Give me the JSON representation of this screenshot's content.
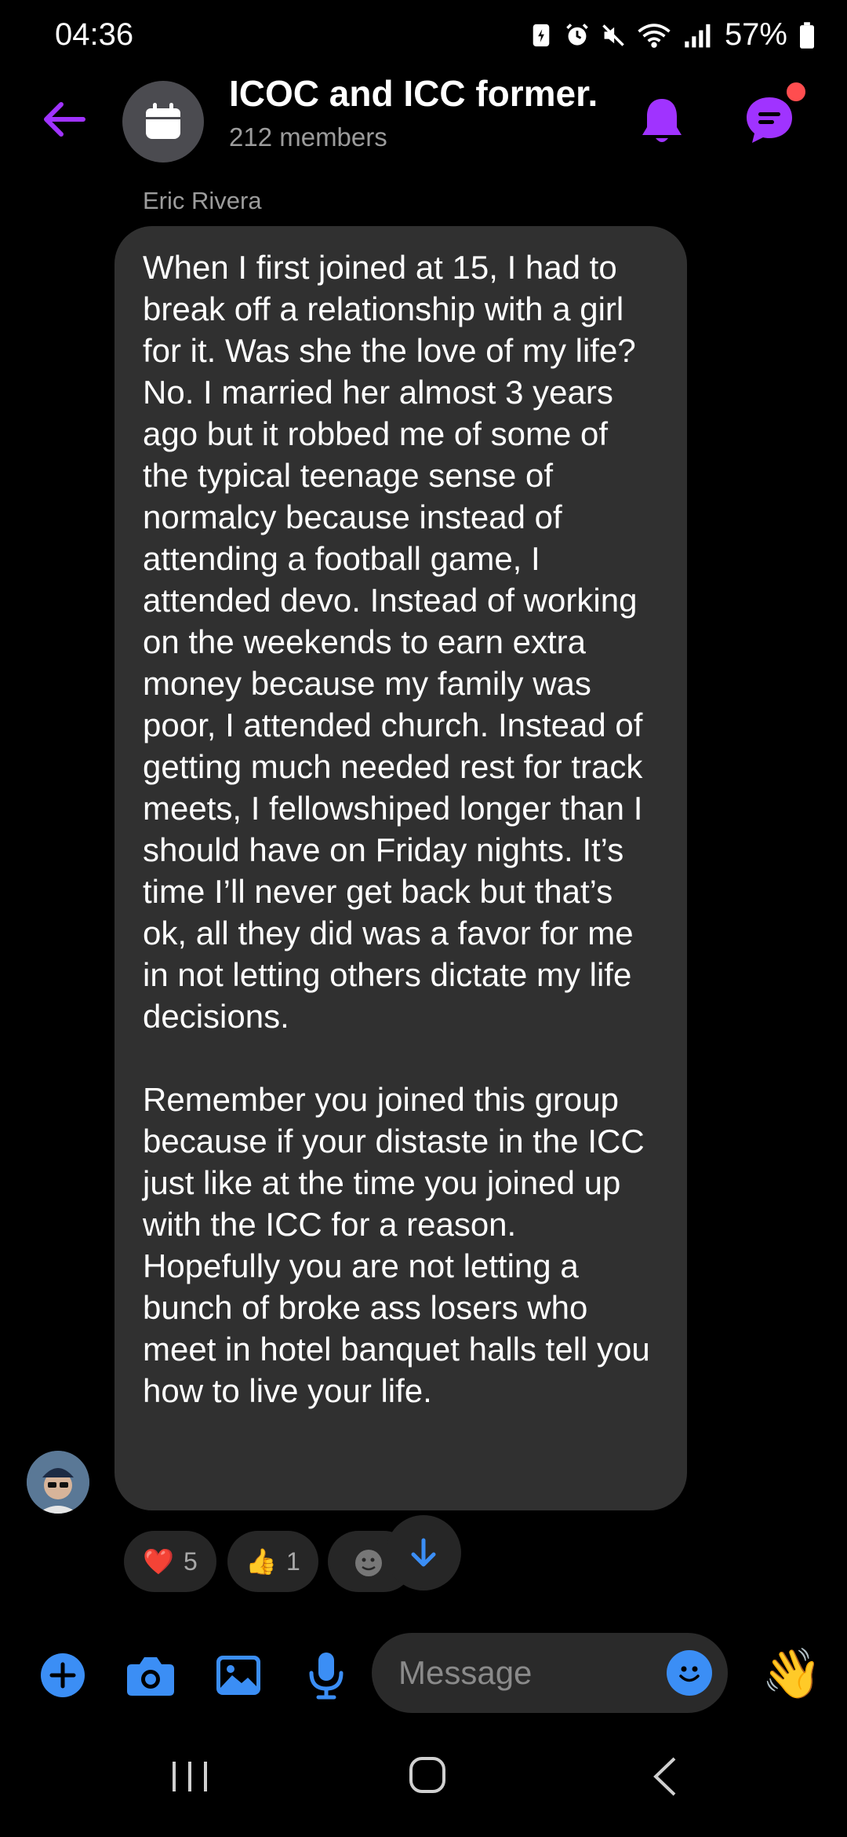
{
  "status_bar": {
    "time": "04:36",
    "battery": "57%"
  },
  "header": {
    "title": "ICOC and ICC former...",
    "subtitle": "212 members"
  },
  "message": {
    "sender": "Eric Rivera",
    "text": "When I first joined at 15, I had to break off a relationship with a girl for it. Was she the love of my life? No. I married her almost 3 years ago but it robbed me of some of the typical teenage sense of normalcy because instead of attending a football game, I attended devo. Instead of working on the weekends to earn extra money because my family was poor, I attended church. Instead of getting much needed rest for track meets, I fellowshiped longer than I should have on Friday nights. It’s time I’ll never get back but that’s ok, all they did was a favor for me in not letting others dictate my life decisions.\n\nRemember you joined this group because if your distaste in the ICC just like at the time you joined up with the ICC for a reason. Hopefully you are not letting a bunch of broke ass losers who meet in hotel banquet halls tell you how to live your life."
  },
  "reactions": [
    {
      "emoji": "❤️",
      "count": "5"
    },
    {
      "emoji": "👍",
      "count": "1"
    }
  ],
  "composer": {
    "placeholder": "Message",
    "wave_emoji": "👋"
  },
  "colors": {
    "accent_purple": "#a033ff",
    "accent_blue": "#3b8ef5",
    "bubble": "#303030",
    "notification": "#ff4d4f"
  },
  "icons": [
    "back-arrow-icon",
    "calendar-icon",
    "bell-icon",
    "threads-icon",
    "plus-icon",
    "camera-icon",
    "gallery-icon",
    "mic-icon",
    "emoji-icon",
    "arrow-down-icon"
  ]
}
